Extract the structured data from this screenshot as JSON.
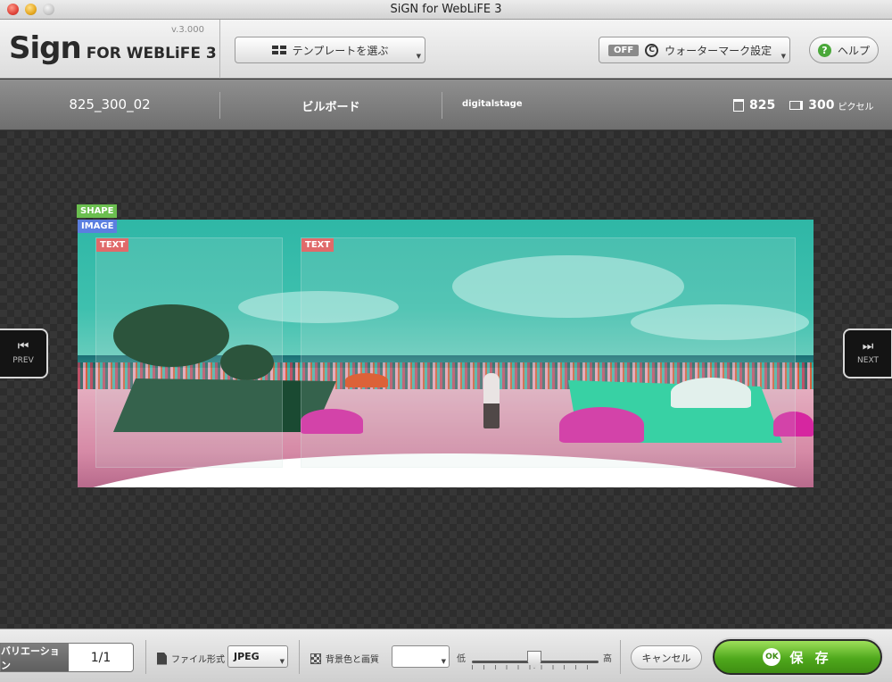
{
  "window": {
    "title": "SiGN for WebLiFE 3"
  },
  "toolbar": {
    "logo_main": "Sign",
    "logo_sub": "FOR WEBLiFE 3",
    "version": "v.3.000",
    "template_button": "テンプレートを選ぶ",
    "watermark_toggle": "OFF",
    "watermark_button": "ウォーターマーク設定",
    "help_button": "ヘルプ"
  },
  "info": {
    "name": "825_300_02",
    "category": "ビルボード",
    "author": "digitalstage",
    "height_value": "825",
    "width_value": "300",
    "unit": "ピクセル"
  },
  "workspace": {
    "prev_label": "PREV",
    "next_label": "NEXT",
    "tags": {
      "shape": "SHAPE",
      "image": "IMAGE",
      "text1": "TEXT",
      "text2": "TEXT"
    }
  },
  "bottom": {
    "variation_label": "バリエーション",
    "variation_count": "1/1",
    "file_format_label": "ファイル形式",
    "file_format_value": "JPEG",
    "bg_quality_label": "背景色と画質",
    "quality_low": "低",
    "quality_high": "高",
    "cancel_button": "キャンセル",
    "save_button": "保 存",
    "ok_icon": "OK"
  },
  "colors": {
    "save_green": "#4fa81c",
    "shape_tag": "#6bbf4f",
    "image_tag": "#5b7fe0",
    "text_tag": "#e06a6a"
  }
}
